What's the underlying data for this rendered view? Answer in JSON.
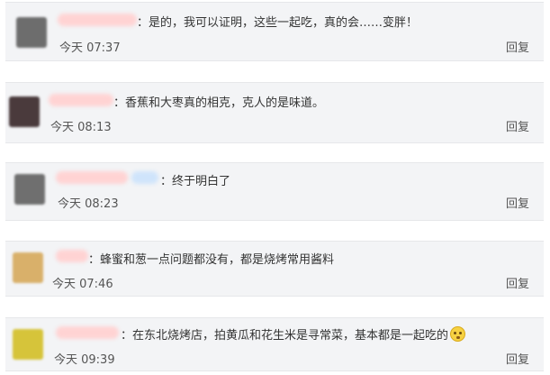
{
  "comments": [
    {
      "text": "：是的，我可以证明，这些一起吃，真的会……变胖！",
      "time": "今天 07:37",
      "reply": "回复"
    },
    {
      "text": "：香蕉和大枣真的相克，克人的是味道。",
      "time": "今天 08:13",
      "reply": "回复"
    },
    {
      "text": "：终于明白了",
      "time": "今天 08:23",
      "reply": "回复"
    },
    {
      "text": "：蜂蜜和葱一点问题都没有，都是烧烤常用酱料",
      "time": "今天 07:46",
      "reply": "回复"
    },
    {
      "text": "：在东北烧烤店，拍黄瓜和花生米是寻常菜，基本都是一起吃的",
      "time": "今天 09:39",
      "reply": "回复",
      "emoji": "astonished-face-emoji"
    }
  ]
}
